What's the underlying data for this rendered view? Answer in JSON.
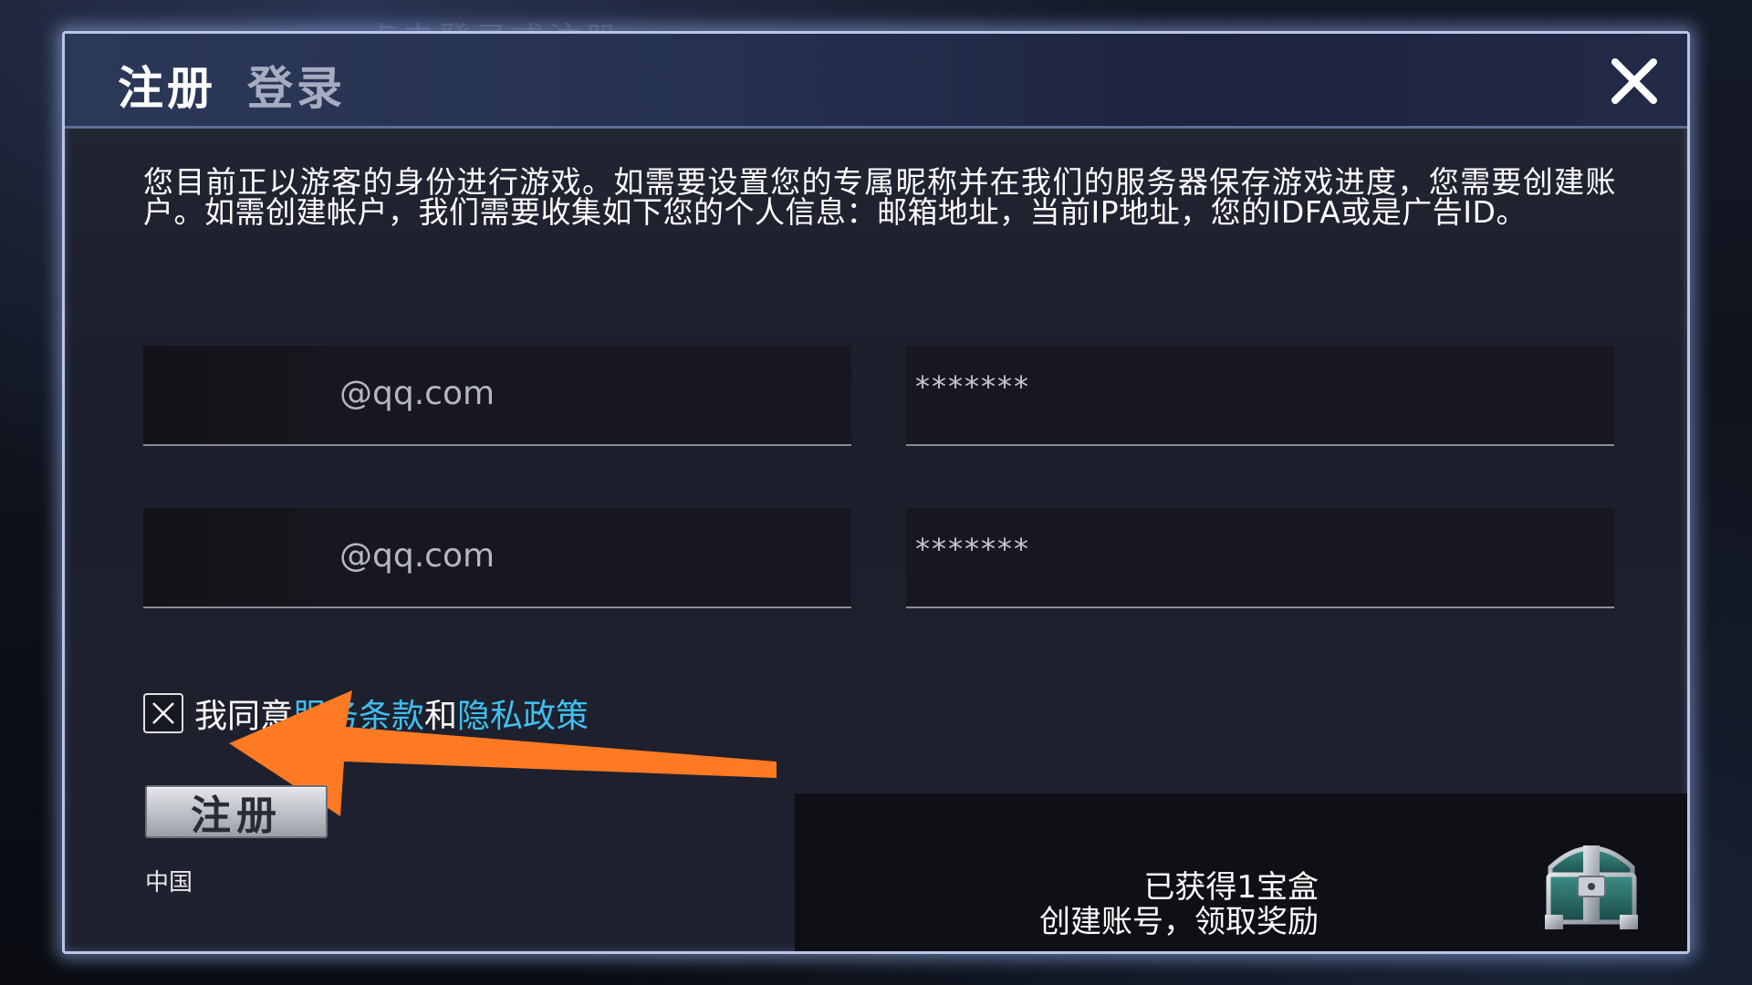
{
  "background": {
    "faded_title": "点击登录或注册"
  },
  "header": {
    "tabs": [
      {
        "label": "注册",
        "active": true
      },
      {
        "label": "登录",
        "active": false
      }
    ],
    "close_icon": "close-icon"
  },
  "info": {
    "text": "您目前正以游客的身份进行游戏。如需要设置您的专属昵称并在我们的服务器保存游戏进度，您需要创建账户。如需创建帐户，我们需要收集如下您的个人信息：邮箱地址，当前IP地址，您的IDFA或是广告ID。"
  },
  "form": {
    "email_value": "@qq.com",
    "email_confirm_value": "@qq.com",
    "password_value": "*******",
    "password_confirm_value": "*******"
  },
  "consent": {
    "checked": true,
    "prefix": "我同意",
    "terms_link": "服务条款",
    "conjunction": "和",
    "privacy_link": "隐私政策"
  },
  "actions": {
    "register_label": "注册",
    "region_label": "中国"
  },
  "reward": {
    "line1": "已获得1宝盒",
    "line2": "创建账号，领取奖励",
    "icon": "treasure-chest-icon"
  },
  "colors": {
    "link": "#3fc0f0",
    "arrow": "#ff7a22",
    "dialog_border": "#b9c6e6"
  }
}
